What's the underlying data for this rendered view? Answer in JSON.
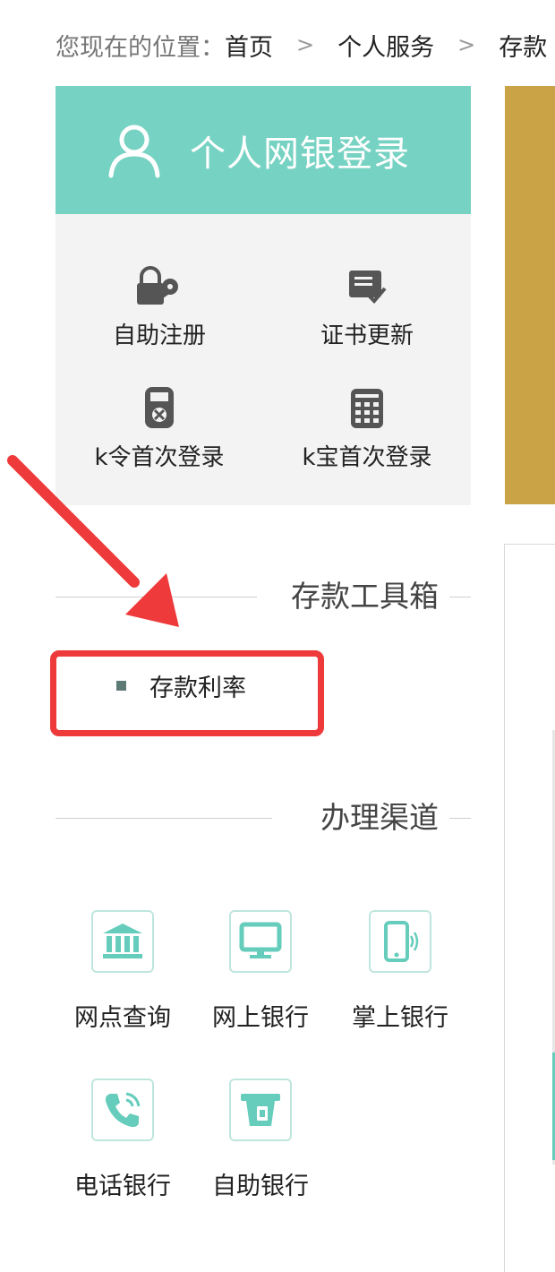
{
  "breadcrumb": {
    "prefix": "您现在的位置：",
    "items": [
      "首页",
      "个人服务",
      "存款"
    ],
    "separator": ">"
  },
  "login": {
    "title": "个人网银登录",
    "items": [
      {
        "label": "自助注册",
        "icon": "lock-key-icon"
      },
      {
        "label": "证书更新",
        "icon": "certificate-icon"
      },
      {
        "label": "k令首次登录",
        "icon": "token-device-icon"
      },
      {
        "label": "k宝首次登录",
        "icon": "usb-key-icon"
      }
    ]
  },
  "tools": {
    "title": "存款工具箱",
    "items": [
      {
        "label": "存款利率"
      }
    ]
  },
  "channels": {
    "title": "办理渠道",
    "items": [
      {
        "label": "网点查询",
        "icon": "bank-building-icon"
      },
      {
        "label": "网上银行",
        "icon": "monitor-icon"
      },
      {
        "label": "掌上银行",
        "icon": "mobile-phone-icon"
      },
      {
        "label": "电话银行",
        "icon": "telephone-icon"
      },
      {
        "label": "自助银行",
        "icon": "atm-icon"
      }
    ]
  },
  "colors": {
    "teal": "#76d2c2",
    "highlight": "#ee3a3a",
    "banner": "#c9a345"
  }
}
